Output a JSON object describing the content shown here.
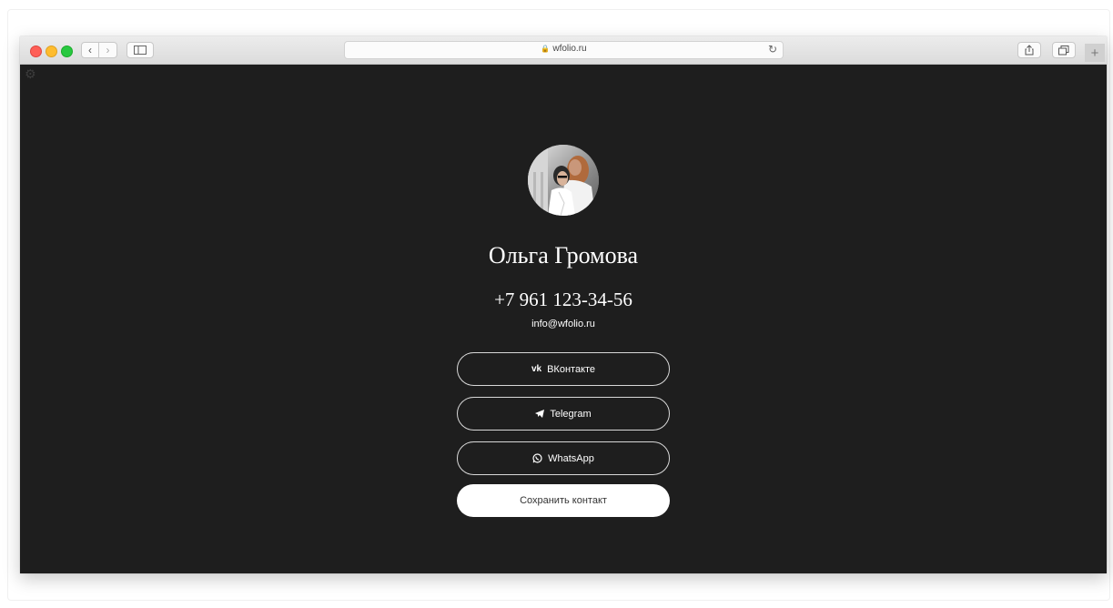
{
  "browser": {
    "url": "wfolio.ru",
    "new_tab_label": "+"
  },
  "profile": {
    "name": "Ольга Громова",
    "phone": "+7 961 123-34-56",
    "email": "info@wfolio.ru"
  },
  "links": [
    {
      "label": "ВКонтакте",
      "icon": "vk-icon"
    },
    {
      "label": "Telegram",
      "icon": "telegram-icon"
    },
    {
      "label": "WhatsApp",
      "icon": "whatsapp-icon"
    }
  ],
  "save_contact_label": "Сохранить контакт",
  "colors": {
    "page_background": "#1e1e1e",
    "text": "#ffffff",
    "save_button_background": "#ffffff"
  }
}
